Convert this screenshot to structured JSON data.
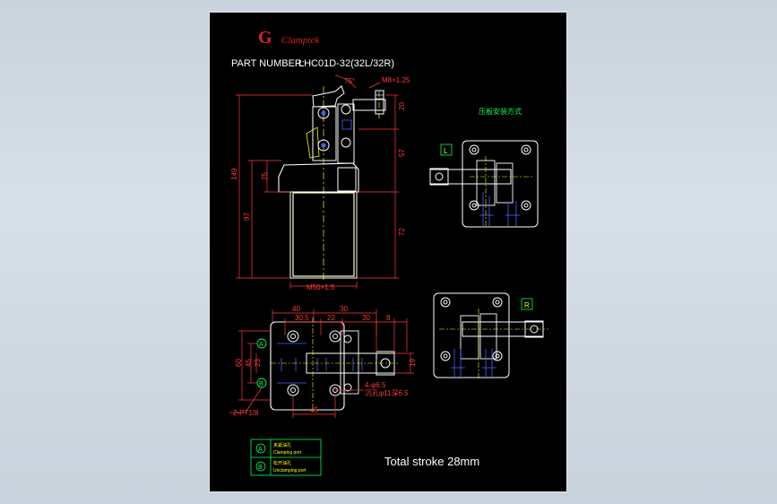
{
  "brand": {
    "name": "Clamptek",
    "logo_color": "#e02020"
  },
  "title": {
    "label": "PART NUMBER:",
    "value": "LHC01D-32(32L/32R)"
  },
  "side_view": {
    "thread_top": "M8×1.25",
    "angle": "75°",
    "dims": {
      "total_height": "149",
      "body_height": "97",
      "flange": "25",
      "upper": "20",
      "mid": "57",
      "lower": "72"
    },
    "thread_bottom": "M50×1.5"
  },
  "mount_note": "压板安装方式",
  "variant_left": "L",
  "variant_right": "R",
  "top_view": {
    "dims_top": [
      "40",
      "30"
    ],
    "dims_second": [
      "30.5",
      "22",
      "30",
      "8"
    ],
    "dims_left": [
      "60",
      "45",
      "23"
    ],
    "dims_right": [
      "19"
    ],
    "dim_bottom": "45",
    "hole_note_1": "4-φ6.5",
    "hole_note_2": "沉孔φ11深6.5",
    "port_note": "2-PT1/8"
  },
  "stroke_label": "Total stroke 28mm",
  "legend": [
    {
      "marker": "A",
      "cn": "夹紧油孔",
      "en": "Clamping port"
    },
    {
      "marker": "B",
      "cn": "松开油孔",
      "en": "Unclamping port"
    }
  ],
  "colors": {
    "background": "#000000",
    "outline": "#ffffff",
    "dimension": "#ff3b3b",
    "centerline": "#ffff00",
    "body": "#ffffcc",
    "note": "#00ff5a",
    "hidden": "#4466ff"
  }
}
